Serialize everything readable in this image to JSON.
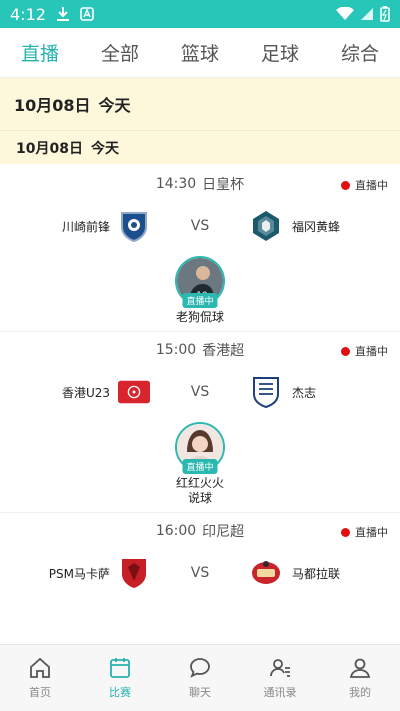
{
  "status_bar": {
    "time": "4:12"
  },
  "tabs": [
    {
      "label": "直播",
      "active": true
    },
    {
      "label": "全部"
    },
    {
      "label": "篮球"
    },
    {
      "label": "足球"
    },
    {
      "label": "综合"
    }
  ],
  "date_banner": {
    "date": "10月08日",
    "day": "今天"
  },
  "date_sub": {
    "date": "10月08日",
    "day": "今天"
  },
  "matches": [
    {
      "time": "14:30",
      "league": "日皇杯",
      "live_label": "直播中",
      "home": "川崎前锋",
      "vs": "VS",
      "away": "福冈黄蜂",
      "streamer": {
        "name": "老狗侃球",
        "tag": "直播中"
      }
    },
    {
      "time": "15:00",
      "league": "香港超",
      "live_label": "直播中",
      "home": "香港U23",
      "vs": "VS",
      "away": "杰志",
      "streamer": {
        "name": "红红火火说球",
        "tag": "直播中"
      }
    },
    {
      "time": "16:00",
      "league": "印尼超",
      "live_label": "直播中",
      "home": "PSM马卡萨",
      "vs": "VS",
      "away": "马都拉联"
    }
  ],
  "bottom_nav": [
    {
      "label": "首页",
      "icon": "home-icon"
    },
    {
      "label": "比赛",
      "icon": "calendar-icon",
      "active": true
    },
    {
      "label": "聊天",
      "icon": "chat-icon"
    },
    {
      "label": "通讯录",
      "icon": "contacts-icon"
    },
    {
      "label": "我的",
      "icon": "profile-icon"
    }
  ],
  "colors": {
    "accent": "#27b3b0",
    "status_bar": "#27c6b8",
    "live_dot": "#e01010",
    "banner_bg": "#fdf7dc"
  }
}
